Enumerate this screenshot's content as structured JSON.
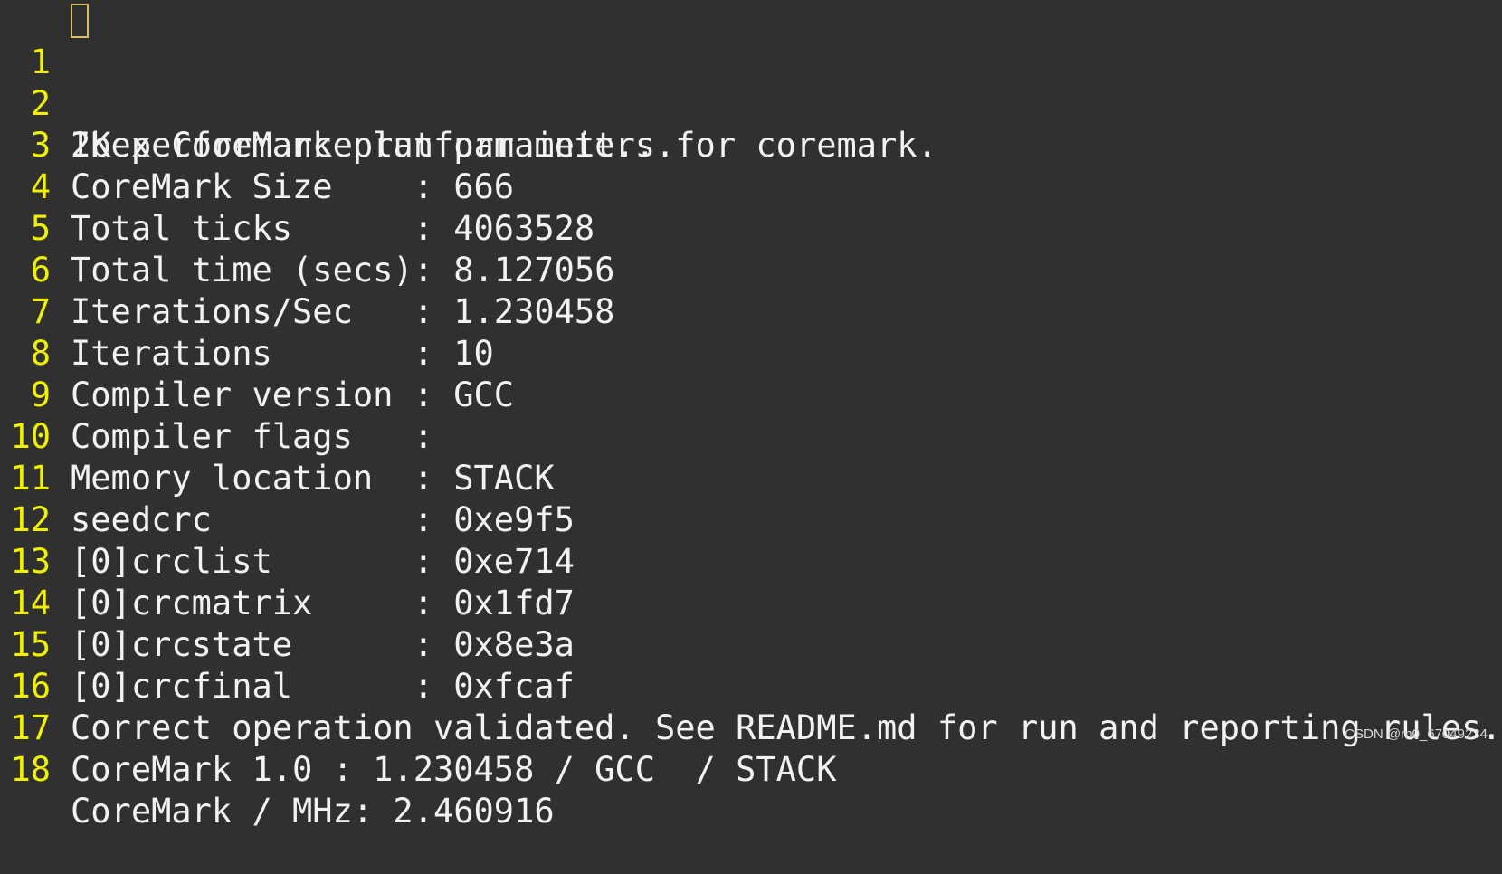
{
  "editor": {
    "lines": [
      {
        "number": "1",
        "text": "Ibex CoreMark platform init..."
      },
      {
        "number": "2",
        "text": "2K performance run parameters for coremark."
      },
      {
        "number": "3",
        "text": "CoreMark Size    : 666"
      },
      {
        "number": "4",
        "text": "Total ticks      : 4063528"
      },
      {
        "number": "5",
        "text": "Total time (secs): 8.127056"
      },
      {
        "number": "6",
        "text": "Iterations/Sec   : 1.230458"
      },
      {
        "number": "7",
        "text": "Iterations       : 10"
      },
      {
        "number": "8",
        "text": "Compiler version : GCC"
      },
      {
        "number": "9",
        "text": "Compiler flags   :"
      },
      {
        "number": "10",
        "text": "Memory location  : STACK"
      },
      {
        "number": "11",
        "text": "seedcrc          : 0xe9f5"
      },
      {
        "number": "12",
        "text": "[0]crclist       : 0xe714"
      },
      {
        "number": "13",
        "text": "[0]crcmatrix     : 0x1fd7"
      },
      {
        "number": "14",
        "text": "[0]crcstate      : 0x8e3a"
      },
      {
        "number": "15",
        "text": "[0]crcfinal      : 0xfcaf"
      },
      {
        "number": "16",
        "text": "Correct operation validated. See README.md for run and reporting rules."
      },
      {
        "number": "17",
        "text": "CoreMark 1.0 : 1.230458 / GCC  / STACK"
      },
      {
        "number": "18",
        "text": "CoreMark / MHz: 2.460916"
      }
    ],
    "cursor_line": "1",
    "colors": {
      "background": "#303030",
      "line_number": "#f0f000",
      "text": "#f2f2f2",
      "cursor": "#d8c060"
    }
  },
  "watermark": "CSDN @m0_67049234"
}
